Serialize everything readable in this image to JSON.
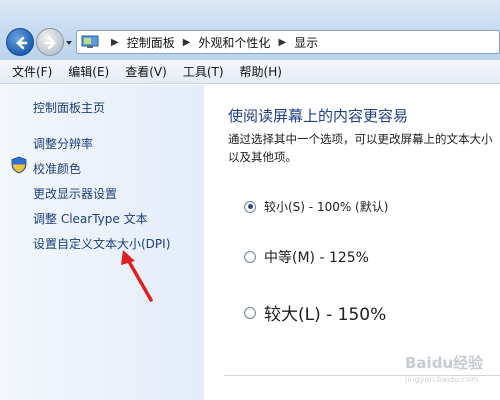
{
  "breadcrumb": {
    "items": [
      "控制面板",
      "外观和个性化",
      "显示"
    ]
  },
  "menu": {
    "items": [
      "文件(F)",
      "编辑(E)",
      "查看(V)",
      "工具(T)",
      "帮助(H)"
    ]
  },
  "sidebar": {
    "home": "控制面板主页",
    "items": [
      "调整分辨率",
      "校准颜色",
      "更改显示器设置",
      "调整 ClearType 文本",
      "设置自定义文本大小(DPI)"
    ]
  },
  "main": {
    "heading": "使阅读屏幕上的内容更容易",
    "description": "通过选择其中一个选项，可以更改屏幕上的文本大小以及其他项。",
    "options": [
      {
        "label": "较小(S) - 100% (默认)",
        "selected": true
      },
      {
        "label": "中等(M) - 125%",
        "selected": false
      },
      {
        "label": "较大(L) - 150%",
        "selected": false
      }
    ]
  },
  "watermark": {
    "brand": "Baidu经验",
    "url": "jingyan.baidu.com"
  },
  "colors": {
    "link": "#1b3f7a",
    "heading": "#1e3f8a",
    "arrow": "#e02020"
  },
  "icons": [
    "back-arrow-icon",
    "forward-arrow-icon",
    "control-panel-icon",
    "shield-icon",
    "red-pointer-arrow"
  ]
}
